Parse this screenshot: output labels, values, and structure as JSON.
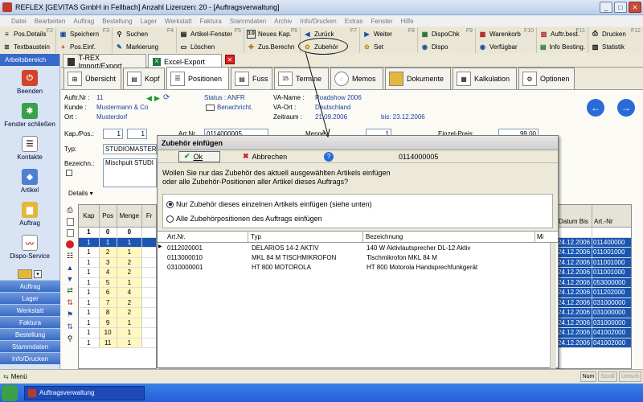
{
  "window": {
    "title": "REFLEX [GEVITAS GmbH in Fellbach] Anzahl Lizenzen: 20 - [Auftragsverwaltung]",
    "controls": [
      "_",
      "□",
      "✕"
    ]
  },
  "menubar": [
    "Datei",
    "Bearbeiten",
    "Auftrag",
    "Bestellung",
    "Lager",
    "Werkstatt",
    "Faktura",
    "Stammdaten",
    "Archiv",
    "Info/Drucken",
    "Extras",
    "Fenster",
    "Hilfe"
  ],
  "toolbar1": [
    {
      "label": "Pos.Details",
      "key": "F2"
    },
    {
      "label": "Speichern",
      "key": "F3"
    },
    {
      "label": "Suchen",
      "key": "F4"
    },
    {
      "label": "Artikel-Fenster",
      "key": "F5"
    },
    {
      "label": "Neues Kap.",
      "key": "F6"
    },
    {
      "label": "Zurück",
      "key": "F7"
    },
    {
      "label": "Weiter",
      "key": "F8"
    },
    {
      "label": "DispoChk",
      "key": "F9"
    },
    {
      "label": "Warenkorb",
      "key": "F10"
    },
    {
      "label": "Auftr.best.",
      "key": "F11"
    },
    {
      "label": "Drucken",
      "key": "F12"
    }
  ],
  "toolbar2": [
    {
      "label": "Textbaustein"
    },
    {
      "label": "Pos.Einf."
    },
    {
      "label": "Markierung"
    },
    {
      "label": "Löschen"
    },
    {
      "label": "Zus.Berechn"
    },
    {
      "label": "Zubehör"
    },
    {
      "label": "Set"
    },
    {
      "label": "Dispo"
    },
    {
      "label": "Verfügbar"
    },
    {
      "label": "Info Besting."
    },
    {
      "label": "Statistik"
    }
  ],
  "left_panel": {
    "header": "Arbeitsbereich",
    "items": [
      "Beenden",
      "Fenster schließen",
      "Kontakte",
      "Artikel",
      "Auftrag",
      "Dispo-Service"
    ],
    "nav": [
      "Auftrag",
      "Lager",
      "Werkstatt",
      "Faktura",
      "Bestellung",
      "Stammdaten",
      "Info/Drucken"
    ]
  },
  "doc_tabs": [
    "T-REX Import/Export",
    "Excel-Export"
  ],
  "page_tabs": [
    "Übersicht",
    "Kopf",
    "Positionen",
    "Fuss",
    "Termine",
    "Memos",
    "Dokumente",
    "Kalkulation",
    "Optionen"
  ],
  "calendar_day": "15",
  "header_info": {
    "auftr_nr_label": "Auftr.Nr :",
    "auftr_nr": "11",
    "kunde_label": "Kunde :",
    "kunde": "Mustermann & Co",
    "ort_label": "Ort :",
    "ort": "Musterdorf",
    "status": "Status : ANFR",
    "benachricht": "Benachricht.",
    "va_name_label": "VA-Name :",
    "va_name": "Roadshow 2006",
    "va_ort_label": "VA-Ort :",
    "va_ort": "Deutschland",
    "zeitraum_label": "Zeitraum :",
    "zeitraum_von": "21.09.2006",
    "zeitraum_bis": "bis: 23.12.2006"
  },
  "pos_form": {
    "kap_pos_label": "Kap./Pos.:",
    "kap": "1",
    "pos": "1",
    "art_nr_label": "Art.Nr",
    "art_nr": "0114000005",
    "menge_label": "Menge",
    "menge": "1",
    "einzelpreis_label": "Einzel-Preis:",
    "einzelpreis": "99,00",
    "typ_label": "Typ:",
    "typ": "STUDIOMASTER",
    "bezeichn_label": "Bezeichn.:",
    "bezeichnung": "Mischpult STUDI",
    "details_label": "Details"
  },
  "left_grid": {
    "columns": [
      "Kap",
      "Pos",
      "Menge",
      "Fr"
    ],
    "rows": [
      [
        "1",
        "0",
        "0"
      ],
      [
        "1",
        "1",
        "1"
      ],
      [
        "1",
        "2",
        "1"
      ],
      [
        "1",
        "3",
        "2"
      ],
      [
        "1",
        "4",
        "2"
      ],
      [
        "1",
        "5",
        "1"
      ],
      [
        "1",
        "6",
        "4"
      ],
      [
        "1",
        "7",
        "2"
      ],
      [
        "1",
        "8",
        "2"
      ],
      [
        "1",
        "9",
        "1"
      ],
      [
        "1",
        "10",
        "1"
      ],
      [
        "1",
        "11",
        "1"
      ]
    ]
  },
  "right_grid": {
    "columns": [
      "Datum Bis",
      "Art.-Nr"
    ],
    "rows": [
      [
        "",
        ""
      ],
      [
        "24.12.2006",
        "011400000"
      ],
      [
        "24.12.2006",
        "011001000"
      ],
      [
        "24.12.2006",
        "011001000"
      ],
      [
        "24.12.2006",
        "011001000"
      ],
      [
        "24.12.2006",
        "053000000"
      ],
      [
        "24.12.2006",
        "011202000"
      ],
      [
        "24.12.2006",
        "031000000"
      ],
      [
        "24.12.2006",
        "031000000"
      ],
      [
        "24.12.2006",
        "031000000"
      ],
      [
        "24.12.2006",
        "041002000"
      ],
      [
        "24.12.2006",
        "041002000"
      ]
    ]
  },
  "dialog": {
    "title": "Zubehör einfügen",
    "ok_label": "Ok",
    "cancel_label": "Abbrechen",
    "article": "0114000005",
    "question": "Wollen Sie nur das Zubehör des aktuell ausgewählten Artikels einfügen oder alle Zubehör-Positionen aller Artikel dieses Auftrags?",
    "option1": "Nur Zubehör dieses einzelnen Artikels einfügen (siehe unten)",
    "option2": "Alle Zubehörpositionen des Auftrags einfügen",
    "columns": [
      "Art.Nr.",
      "Typ",
      "Bezeichnung",
      "Mi"
    ],
    "rows": [
      [
        "0112020001",
        "DELARIOS 14-2 AKTIV",
        "140 W Aktivlautsprecher DL-12 Aktiv"
      ],
      [
        "0113000010",
        "MKL 84 M TISCHMIKROFON",
        "Tischmikrofon MKL 84 M"
      ],
      [
        "0310000001",
        "HT 800 MOTOROLA",
        "HT 800 Motorola Handsprechfunkgerät"
      ]
    ]
  },
  "statusbar": {
    "menu_label": "Menü",
    "num": "Num",
    "scroll": "Scroll",
    "umsch": "Umsch"
  },
  "taskbar": {
    "item": "Auftragsverwaltung"
  }
}
